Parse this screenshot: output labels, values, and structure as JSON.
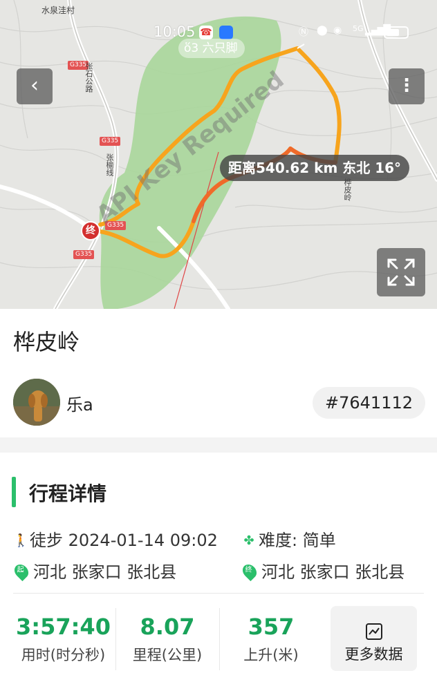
{
  "status_bar": {
    "time": "10:05",
    "network": "5G"
  },
  "map": {
    "watermark": "六只脚",
    "distance_tag": "距离540.62 km 东北 16°",
    "end_marker": "终",
    "api_watermark": "API Key Required",
    "labels": {
      "village": "水泉洼村",
      "place": "桦皮岭",
      "road_g335_1": "G335",
      "road_g335_2": "G335",
      "road_g335_3": "G335",
      "road_g335_4": "G335",
      "road_name_1": "张石公路",
      "road_name_2": "张榆线"
    },
    "track_colors": {
      "track": "#f7a41d",
      "track_end": "#ef6a2a",
      "vegetation": "#a8d69a"
    }
  },
  "route": {
    "title": "桦皮岭",
    "user_name": "乐a",
    "track_id": "#7641112"
  },
  "details": {
    "section_title": "行程详情",
    "activity": "徒步 2024-01-14 09:02",
    "difficulty": "难度:  简单",
    "start_label": "起",
    "start_location": "河北 张家口 张北县",
    "end_label": "终",
    "end_location": "河北 张家口 张北县"
  },
  "stats": {
    "duration_value": "3:57:40",
    "duration_label": "用时(时分秒)",
    "distance_value": "8.07",
    "distance_label": "里程(公里)",
    "ascent_value": "357",
    "ascent_label": "上升(米)",
    "more_label": "更多数据"
  },
  "accent_color": "#2bbf6b"
}
